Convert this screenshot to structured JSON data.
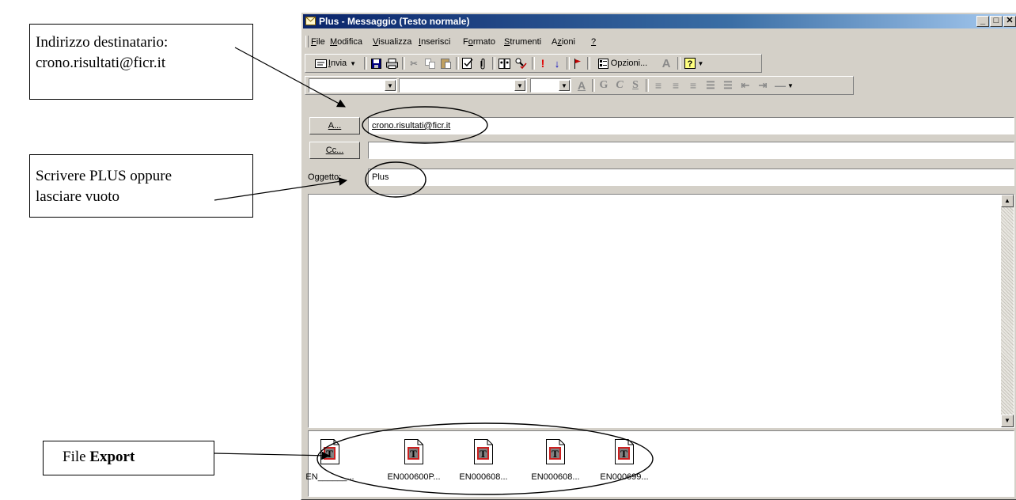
{
  "callouts": {
    "to_line1": "Indirizzo destinatario:",
    "to_line2": "crono.risultati@ficr.it",
    "subject_line1": "Scrivere PLUS oppure",
    "subject_line2": "lasciare vuoto",
    "export_prefix": "File ",
    "export_bold": "Export"
  },
  "window": {
    "title": "Plus - Messaggio (Testo normale)",
    "caption_buttons": [
      "minimize",
      "maximize",
      "close"
    ]
  },
  "menu": [
    {
      "acc": "F",
      "rest": "ile"
    },
    {
      "acc": "M",
      "rest": "odifica"
    },
    {
      "acc": "V",
      "rest": "isualizza"
    },
    {
      "acc": "I",
      "rest": "nserisci"
    },
    {
      "pre": "F",
      "acc": "o",
      "rest": "rmato"
    },
    {
      "acc": "S",
      "rest": "trumenti"
    },
    {
      "pre": "A",
      "acc": "z",
      "rest": "ioni"
    },
    {
      "acc": "?",
      "rest": ""
    }
  ],
  "toolbar": {
    "send_label": "Invia",
    "send_accel": "I",
    "options_label": "Opzioni...",
    "options_accel": "z",
    "icons": [
      "send-icon",
      "save-icon",
      "print-icon",
      "cut-icon",
      "copy-icon",
      "paste-icon",
      "check-names-icon",
      "attach-icon",
      "address-book-icon",
      "spell-check-icon",
      "importance-high-icon",
      "importance-low-icon",
      "flag-icon",
      "options-icon",
      "font-color-icon",
      "help-icon"
    ]
  },
  "format_toolbar": {
    "bold_glyph": "G",
    "italic_glyph": "C",
    "underline_glyph": "S",
    "font_color_glyph": "A"
  },
  "header": {
    "to_button": "A...",
    "to_value": "crono.risultati@ficr.it",
    "cc_button": "Cc...",
    "cc_value": "",
    "subject_label": "Oggetto:",
    "subject_value": "Plus"
  },
  "attachments": [
    {
      "name": "EN______..."
    },
    {
      "name": "EN000600P..."
    },
    {
      "name": "EN000608..."
    },
    {
      "name": "EN000608..."
    },
    {
      "name": "EN000699..."
    }
  ],
  "colors": {
    "title_start": "#0a246a",
    "title_end": "#a6caf0",
    "window_face": "#d4d0c8",
    "attachment_red": "#cc2020"
  }
}
